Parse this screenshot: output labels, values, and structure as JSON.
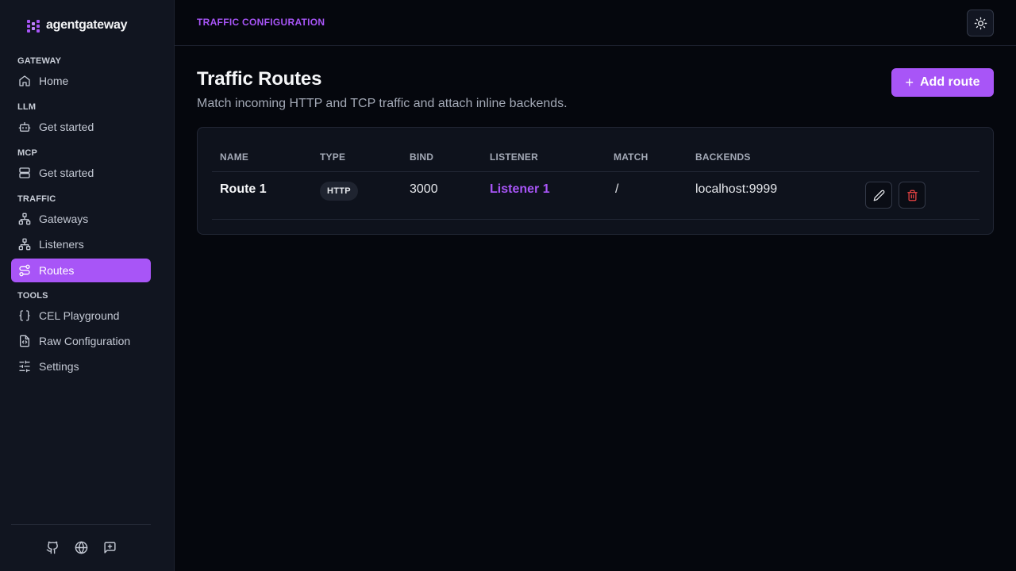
{
  "app": {
    "name": "agentgateway"
  },
  "sidebar": {
    "sections": [
      {
        "label": "GATEWAY",
        "items": [
          {
            "label": "Home",
            "icon": "home-icon"
          }
        ]
      },
      {
        "label": "LLM",
        "items": [
          {
            "label": "Get started",
            "icon": "bot-icon"
          }
        ]
      },
      {
        "label": "MCP",
        "items": [
          {
            "label": "Get started",
            "icon": "server-icon"
          }
        ]
      },
      {
        "label": "TRAFFIC",
        "items": [
          {
            "label": "Gateways",
            "icon": "network-icon"
          },
          {
            "label": "Listeners",
            "icon": "network-icon"
          },
          {
            "label": "Routes",
            "icon": "route-icon",
            "active": true
          }
        ]
      },
      {
        "label": "TOOLS",
        "items": [
          {
            "label": "CEL Playground",
            "icon": "braces-icon"
          },
          {
            "label": "Raw Configuration",
            "icon": "file-code-icon"
          },
          {
            "label": "Settings",
            "icon": "sliders-icon"
          }
        ]
      }
    ],
    "footer_icons": [
      "github-icon",
      "globe-icon",
      "feedback-icon"
    ]
  },
  "header": {
    "breadcrumb": "TRAFFIC CONFIGURATION",
    "theme_icon": "sun-icon"
  },
  "main": {
    "title": "Traffic Routes",
    "subtitle": "Match incoming HTTP and TCP traffic and attach inline backends.",
    "add_button": "Add route",
    "table": {
      "columns": [
        "NAME",
        "TYPE",
        "BIND",
        "LISTENER",
        "MATCH",
        "BACKENDS"
      ],
      "rows": [
        {
          "name": "Route 1",
          "type": "HTTP",
          "bind": "3000",
          "listener": "Listener 1",
          "match": "/",
          "backends": "localhost:9999"
        }
      ]
    }
  },
  "colors": {
    "accent": "#a855f7",
    "background": "#05070d",
    "sidebar": "#111520",
    "danger": "#ef4444"
  }
}
